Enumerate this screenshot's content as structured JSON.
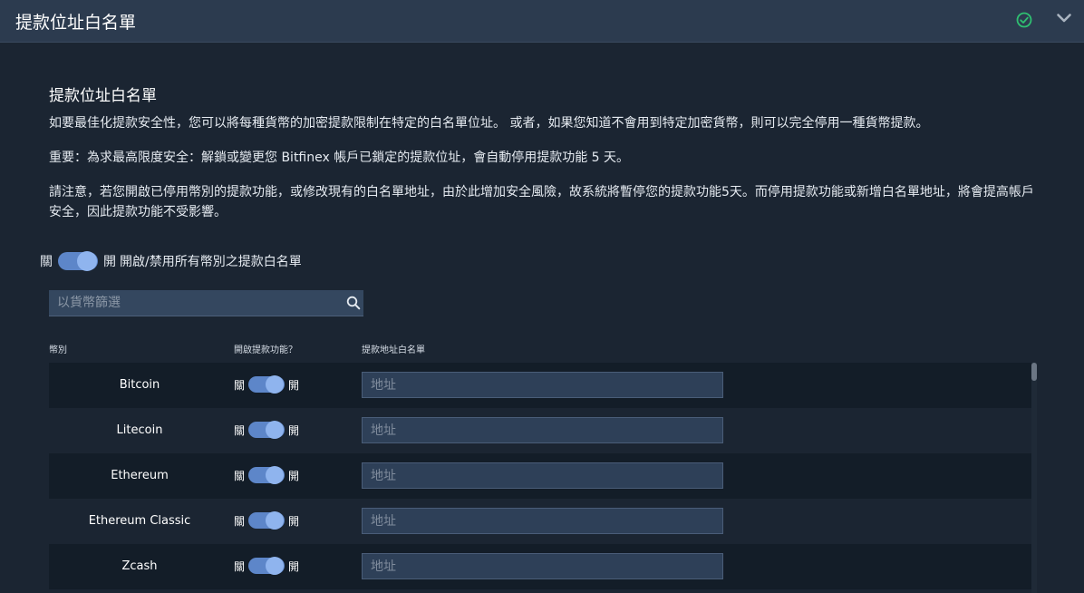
{
  "header": {
    "title": "提款位址白名單",
    "status_icon": "check-circle-icon",
    "collapse_icon": "chevron-down-icon",
    "accent": "#2fbf71"
  },
  "section": {
    "title": "提款位址白名單",
    "paragraph1": "如要最佳化提款安全性，您可以將每種貨幣的加密提款限制在特定的白名單位址。 或者，如果您知道不會用到特定加密貨幣，則可以完全停用一種貨幣提款。",
    "paragraph2": "重要：為求最高限度安全：解鎖或變更您 Bitfinex 帳戶已鎖定的提款位址，會自動停用提款功能 5 天。",
    "paragraph3": "請注意，若您開啟已停用幣別的提款功能，或修改現有的白名單地址，由於此增加安全風險，故系統將暫停您的提款功能5天。而停用提款功能或新增白名單地址，將會提高帳戶安全，因此提款功能不受影響。"
  },
  "master_toggle": {
    "off_label": "關",
    "on_label": "開",
    "description": "開啟/禁用所有幣別之提款白名單",
    "state": "on"
  },
  "search": {
    "placeholder": "以貨幣篩選",
    "value": "",
    "icon": "search-icon"
  },
  "table": {
    "headers": [
      "幣別",
      "開啟提款功能？",
      "提款地址白名單"
    ],
    "rows": [
      {
        "currency": "Bitcoin",
        "off_label": "關",
        "on_label": "開",
        "enabled": true,
        "address_placeholder": "地址",
        "address": ""
      },
      {
        "currency": "Litecoin",
        "off_label": "關",
        "on_label": "開",
        "enabled": true,
        "address_placeholder": "地址",
        "address": ""
      },
      {
        "currency": "Ethereum",
        "off_label": "關",
        "on_label": "開",
        "enabled": true,
        "address_placeholder": "地址",
        "address": ""
      },
      {
        "currency": "Ethereum Classic",
        "off_label": "關",
        "on_label": "開",
        "enabled": true,
        "address_placeholder": "地址",
        "address": ""
      },
      {
        "currency": "Zcash",
        "off_label": "關",
        "on_label": "開",
        "enabled": true,
        "address_placeholder": "地址",
        "address": ""
      }
    ]
  },
  "colors": {
    "toggle_track": "#5d86c9",
    "toggle_knob": "#8fb4ee",
    "background": "#1b2532",
    "header_bg": "#2c3b4f"
  }
}
